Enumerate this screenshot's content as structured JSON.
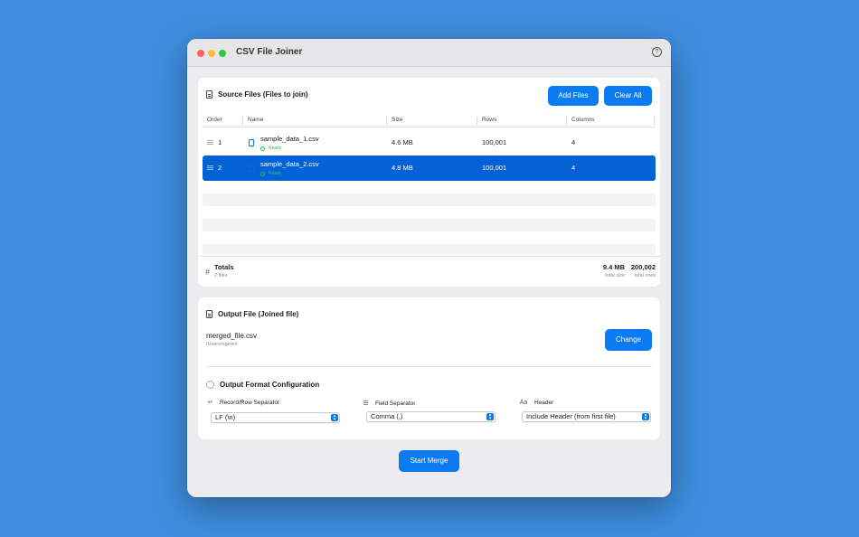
{
  "window": {
    "title": "CSV File Joiner",
    "help": "?"
  },
  "source": {
    "title": "Source Files (Files to join)",
    "add_label": "Add Files",
    "clear_label": "Clear All",
    "columns": [
      "Order",
      "Name",
      "Size",
      "Rows",
      "Columns"
    ],
    "rows": [
      {
        "order": "1",
        "name": "sample_data_1.csv",
        "status": "Ready",
        "size": "4.6 MB",
        "rows": "100,001",
        "columns": "4",
        "selected": false
      },
      {
        "order": "2",
        "name": "sample_data_2.csv",
        "status": "Ready",
        "size": "4.8 MB",
        "rows": "100,001",
        "columns": "4",
        "selected": true
      }
    ],
    "totals": {
      "label": "Totals",
      "files": "2 files",
      "size": "9.4 MB",
      "size_label": "total size",
      "rows": "200,002",
      "rows_label": "total rows"
    }
  },
  "output": {
    "title": "Output File (Joined file)",
    "filename": "merged_file.csv",
    "path": "/Users/ngeren",
    "change_label": "Change",
    "config_title": "Output Format Configuration",
    "record_sep": {
      "label": "Record/Row Separator",
      "value": "LF (\\n)"
    },
    "field_sep": {
      "label": "Field Separator",
      "value": "Comma (,)"
    },
    "header": {
      "label": "Header",
      "value": "Include Header (from first file)"
    }
  },
  "merge_label": "Start Merge",
  "colors": {
    "accent": "#0a7bf0",
    "selection": "#0562d6",
    "ready": "#2fb84e",
    "desktop": "#3f8ee0"
  }
}
